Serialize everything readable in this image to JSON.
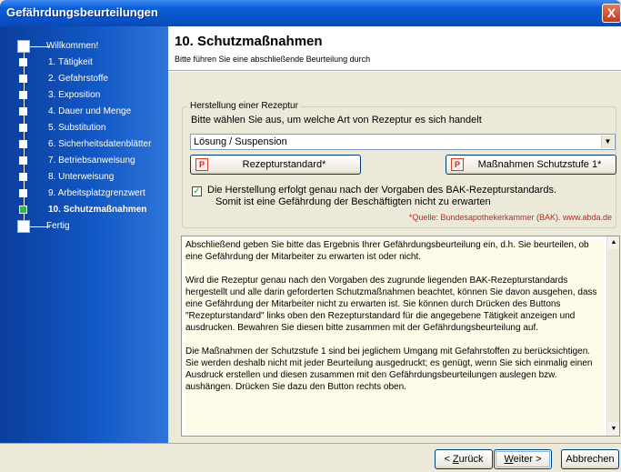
{
  "window": {
    "title": "Gefährdungsbeurteilungen",
    "close_label": "X"
  },
  "sidebar": {
    "items": [
      {
        "label": "Willkommen!"
      },
      {
        "label": "1. Tätigkeit"
      },
      {
        "label": "2. Gefahrstoffe"
      },
      {
        "label": "3. Exposition"
      },
      {
        "label": "4. Dauer und Menge"
      },
      {
        "label": "5. Substitution"
      },
      {
        "label": "6. Sicherheitsdatenblätter"
      },
      {
        "label": "7. Betriebsanweisung"
      },
      {
        "label": "8. Unterweisung"
      },
      {
        "label": "9. Arbeitsplatzgrenzwert"
      },
      {
        "label": "10. Schutzmaßnahmen"
      },
      {
        "label": "Fertig"
      }
    ]
  },
  "header": {
    "title": "10. Schutzmaßnahmen",
    "subtitle": "Bitte führen Sie eine abschließende Beurteilung durch"
  },
  "group": {
    "legend": "Herstellung einer Rezeptur",
    "question": "Bitte wählen Sie aus, um welche Art von Rezeptur es sich handelt",
    "combo_value": "Lösung / Suspension",
    "btn_left": "Rezepturstandard*",
    "btn_right": "Maßnahmen Schutzstufe 1*",
    "check_line1": "Die Herstellung erfolgt genau nach der Vorgaben des BAK-Rezepturstandards.",
    "check_line2": "Somit ist eine Gefährdung der Beschäftigten nicht zu erwarten",
    "checked": true,
    "source": "*Quelle: Bundesapothekerkammer (BAK). www.abda.de"
  },
  "text": {
    "p1": "Abschließend geben Sie bitte das Ergebnis Ihrer Gefährdungsbeurteilung ein, d.h. Sie beurteilen, ob eine Gefährdung der Mitarbeiter zu erwarten ist oder nicht.",
    "p2": "Wird die Rezeptur genau nach den Vorgaben des zugrunde liegenden BAK-Rezepturstandards hergestellt und alle darin geforderten Schutzmaßnahmen beachtet, können Sie davon ausgehen, dass eine Gefährdung der Mitarbeiter nicht zu erwarten ist. Sie können durch Drücken des Buttons \"Rezepturstandard\" links oben den Rezepturstandard für die angegebene Tätigkeit anzeigen und ausdrucken. Bewahren Sie diesen bitte zusammen mit der Gefährdungsbeurteilung auf.",
    "p3": "Die Maßnahmen der Schutzstufe 1 sind bei jeglichem Umgang mit Gefahrstoffen zu berücksichtigen. Sie werden deshalb nicht mit jeder Beurteilung ausgedruckt; es genügt, wenn Sie sich einmalig einen Ausdruck erstellen und diesen zusammen mit den Gefährdungsbeurteilungen auslegen bzw. aushängen. Drücken Sie dazu den Button rechts oben."
  },
  "footer": {
    "back_prefix": "< ",
    "back_accel": "Z",
    "back_rest": "urück",
    "next_accel": "W",
    "next_rest": "eiter >",
    "cancel": "Abbrechen"
  },
  "colors": {
    "active_step": "#2dbb3f",
    "source_text": "#c0281d"
  }
}
